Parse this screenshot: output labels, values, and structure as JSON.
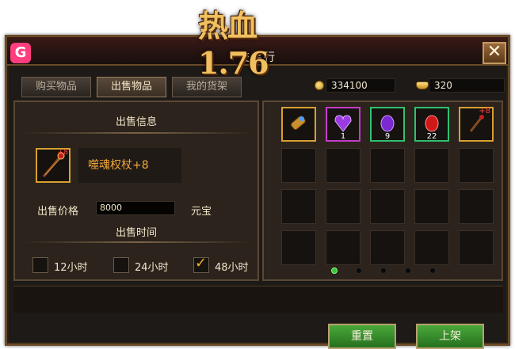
{
  "logo": {
    "text": "热血1.76"
  },
  "window": {
    "subtitle": "交易行",
    "close_label": "✕"
  },
  "tabs": [
    {
      "label": "购买物品",
      "active": false
    },
    {
      "label": "出售物品",
      "active": true
    },
    {
      "label": "我的货架",
      "active": false
    }
  ],
  "currency": {
    "gold": "334100",
    "yuanbao": "320"
  },
  "sell_info": {
    "title": "出售信息",
    "item_name": "噬魂权杖+8",
    "item_plus": "+8",
    "price_label": "出售价格",
    "price_value": "8000",
    "price_unit": "元宝",
    "time_title": "出售时间",
    "time_options": [
      {
        "label": "12小时",
        "checked": false
      },
      {
        "label": "24小时",
        "checked": false
      },
      {
        "label": "48小时",
        "checked": true
      }
    ]
  },
  "inventory": {
    "items": [
      {
        "icon": "scroll-icon",
        "quality": "gold",
        "qty": ""
      },
      {
        "icon": "purple-heart-gem-icon",
        "quality": "purple",
        "qty": "1"
      },
      {
        "icon": "purple-gem-icon",
        "quality": "green",
        "qty": "9"
      },
      {
        "icon": "red-gem-icon",
        "quality": "green",
        "qty": "22"
      },
      {
        "icon": "scepter-icon",
        "quality": "gold",
        "qty": "+8"
      }
    ],
    "page": 1,
    "page_count": 5
  },
  "buttons": {
    "reset": "重置",
    "list": "上架"
  }
}
